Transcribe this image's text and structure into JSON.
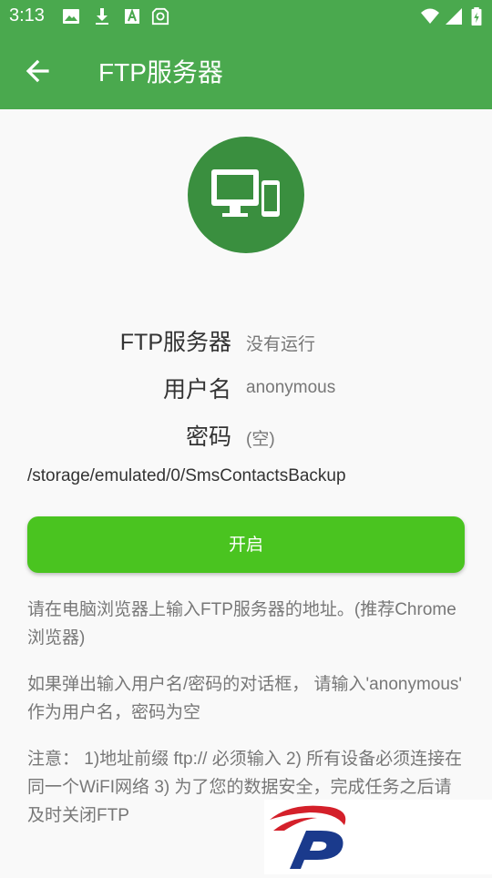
{
  "status_bar": {
    "time": "3:13",
    "icons_left": [
      "image-icon",
      "download-icon",
      "font-a-icon",
      "sd-card-icon"
    ],
    "icons_right": [
      "wifi-icon",
      "signal-icon",
      "battery-icon"
    ]
  },
  "app_bar": {
    "title": "FTP服务器",
    "back_icon": "arrow-back-icon"
  },
  "hero_icon": "devices-icon",
  "info": [
    {
      "label": "FTP服务器",
      "value": "没有运行"
    },
    {
      "label": "用户名",
      "value": "anonymous"
    },
    {
      "label": "密码",
      "value": "(空)"
    }
  ],
  "path": "/storage/emulated/0/SmsContactsBackup",
  "start_button": "开启",
  "instructions": [
    "请在电脑浏览器上输入FTP服务器的地址。(推荐Chrome浏览器)",
    "如果弹出输入用户名/密码的对话框， 请输入'anonymous' 作为用户名，密码为空",
    "注意： 1)地址前缀 ftp:// 必须输入 2) 所有设备必须连接在同一个WiFI网络 3) 为了您的数据安全，完成任务之后请及时关闭FTP"
  ],
  "colors": {
    "primary": "#4aa94e",
    "hero_bg": "#3a8f3f",
    "button": "#4ac420",
    "background": "#f9f9f9"
  }
}
